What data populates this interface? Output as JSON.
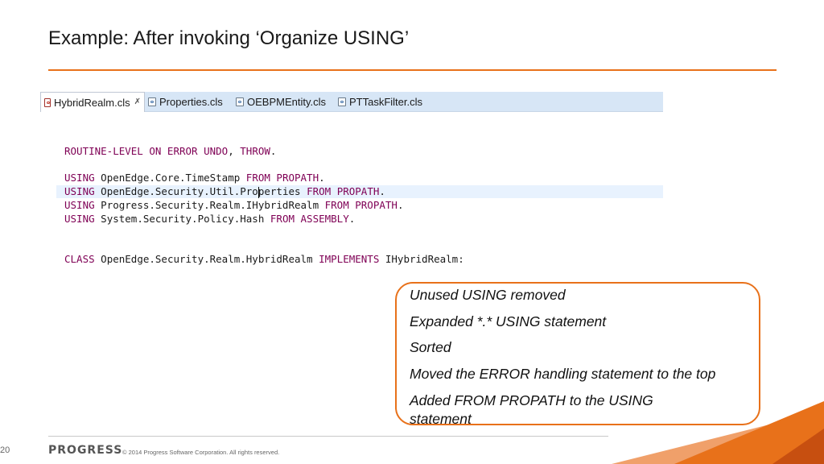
{
  "slide": {
    "title": "Example: After invoking ‘Organize USING’",
    "page_number": "20",
    "brand": "PROGRESS",
    "copyright": "© 2014 Progress Software Corporation. All rights reserved."
  },
  "editor": {
    "tabs": [
      {
        "label": "HybridRealm.cls",
        "close_glyph": "✗",
        "active": true
      },
      {
        "label": "Properties.cls",
        "active": false
      },
      {
        "label": "OEBPMEntity.cls",
        "active": false
      },
      {
        "label": "PTTaskFilter.cls",
        "active": false
      }
    ],
    "code": {
      "line1": {
        "kw1": "ROUTINE-LEVEL ON ERROR UNDO",
        "sep": ", ",
        "kw2": "THROW",
        "end": "."
      },
      "line2": {
        "kw1": "USING",
        "name": " OpenEdge.Core.TimeStamp ",
        "kw2": "FROM PROPATH",
        "end": "."
      },
      "line3": {
        "kw1": "USING",
        "name_a": " OpenEdge.Security.Util.Pro",
        "name_b": "perties ",
        "kw2": "FROM PROPATH",
        "end": "."
      },
      "line4": {
        "kw1": "USING",
        "name": " Progress.Security.Realm.IHybridRealm ",
        "kw2": "FROM PROPATH",
        "end": "."
      },
      "line5": {
        "kw1": "USING",
        "name": " System.Security.Policy.Hash ",
        "kw2": "FROM ASSEMBLY",
        "end": "."
      },
      "line6": {
        "kw1": "CLASS",
        "name": " OpenEdge.Security.Realm.HybridRealm ",
        "kw2": "IMPLEMENTS",
        "name2": " IHybridRealm:"
      }
    }
  },
  "callout": {
    "items": [
      "Unused USING removed",
      "Expanded *.* USING statement",
      "Sorted",
      "Moved the ERROR handling statement to the top",
      "Added FROM PROPATH to the USING statement"
    ]
  },
  "colors": {
    "accent": "#e8711a",
    "keyword": "#7f0055",
    "tabbar": "#d7e6f6"
  }
}
